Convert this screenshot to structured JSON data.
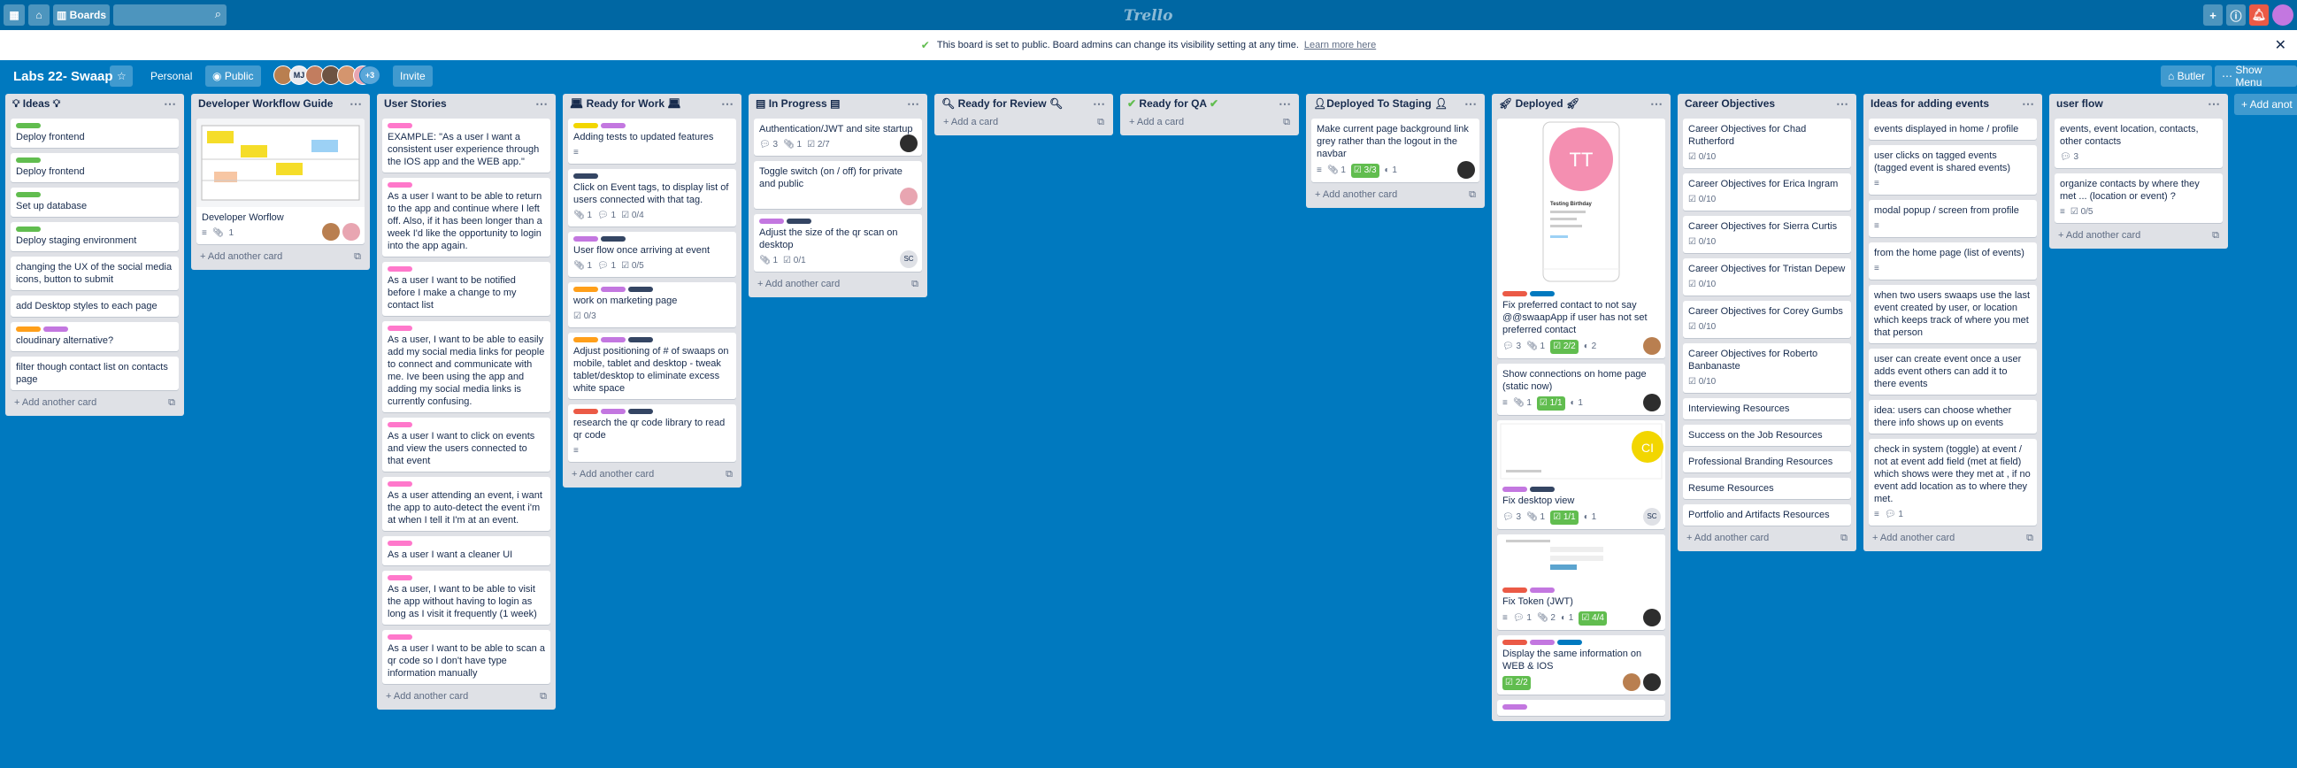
{
  "topbar": {
    "boards_label": "Boards",
    "logo": "Trello"
  },
  "banner": {
    "text": "This board is set to public. Board admins can change its visibility setting at any time.",
    "link": "Learn more here"
  },
  "board": {
    "title": "Labs 22- Swaap",
    "team": "Personal",
    "visibility": "Public",
    "member_more": "+3",
    "invite": "Invite",
    "butler": "Butler",
    "show_menu": "Show Menu",
    "member_initials": "MJ"
  },
  "add_card_label": "Add a card",
  "add_another_card_label": "Add another card",
  "add_list_label": "+ Add anot",
  "lists": {
    "ideas": {
      "title": "Ideas",
      "cards": [
        "Deploy frontend",
        "Deploy frontend",
        "Set up database",
        "Deploy staging environment",
        "changing the UX of the social media icons, button to submit",
        "add Desktop styles to each page",
        "cloudinary alternative?",
        "filter though contact list on contacts page"
      ]
    },
    "dev": {
      "title": "Developer Workflow Guide",
      "cards": [
        "Developer Worflow"
      ],
      "badge": "1"
    },
    "stories": {
      "title": "User Stories",
      "cards": [
        "EXAMPLE: \"As a user I want a consistent user experience through the IOS app and the WEB app.\"",
        "As a user I want to be able to return to the app and continue where I left off. Also, if it has been longer than a week I'd like the opportunity to login into the app again.",
        "As a user I want to be notified before I make a change to my contact list",
        "As a user, I want to be able to easily add my social media links for people to connect and communicate with me. Ive been using the app and adding my social media links is currently confusing.",
        "As a user I want to click on events and view the users connected to that event",
        "As a user attending an event, i want the app to auto-detect the event i'm at when I tell it I'm at an event.",
        "As a user I want a cleaner UI",
        "As a user, I want to be able to visit the app without having to login as long as I visit it frequently (1 week)",
        "As a user I want to be able to scan a qr code so I don't have type information manually"
      ]
    },
    "ready_work": {
      "title": "Ready for Work",
      "cards": [
        "Adding tests to updated features",
        "Click on Event tags, to display list of users connected with that tag.",
        "User flow once arriving at event",
        "work on marketing page",
        "Adjust positioning of # of swaaps on mobile, tablet and desktop - tweak tablet/desktop to eliminate excess white space",
        "research the qr code library to read qr code"
      ],
      "b1": "1",
      "b2": "1",
      "b3": "0/4",
      "b4": "1",
      "b5": "1",
      "b6": "0/5",
      "b7": "0/3"
    },
    "progress": {
      "title": "In Progress",
      "cards": [
        "Authentication/JWT and site startup",
        "Toggle switch (on / off) for private and public",
        "Adjust the size of the qr scan on desktop"
      ],
      "b1": "3",
      "b2": "1",
      "b3": "2/7",
      "b4": "1",
      "b5": "0/1",
      "sc": "SC"
    },
    "review": {
      "title": "Ready for Review"
    },
    "qa": {
      "title": "Ready for QA"
    },
    "staging": {
      "title": "Deployed To Staging",
      "cards": [
        "Make current page background link grey rather than the logout in the navbar"
      ],
      "b1": "1",
      "b2": "3/3",
      "b3": "1"
    },
    "deployed": {
      "title": "Deployed",
      "cards": [
        "Fix preferred contact to not say @@swaapApp if user has not set preferred contact",
        "Show connections on home page (static now)",
        "Fix desktop view",
        "Fix Token (JWT)",
        "Display the same information on WEB & IOS"
      ],
      "tt": "TT",
      "ci": "CI",
      "sc": "SC",
      "preview_name": "Testing Birthday",
      "c1b": [
        "3",
        "1",
        "2/2",
        "2"
      ],
      "c2b": [
        "1",
        "1/1",
        "1"
      ],
      "c3b": [
        "3",
        "1",
        "1/1",
        "1"
      ],
      "c4b": [
        "1",
        "2",
        "1",
        "4/4"
      ],
      "c5b": [
        "2/2"
      ]
    },
    "career": {
      "title": "Career Objectives",
      "cards": [
        "Career Objectives for Chad Rutherford",
        "Career Objectives for Erica Ingram",
        "Career Objectives for Sierra Curtis",
        "Career Objectives for Tristan Depew",
        "Career Objectives for Corey Gumbs",
        "Career Objectives for Roberto Banbanaste",
        "Interviewing Resources",
        "Success on the Job Resources",
        "Professional Branding Resources",
        "Resume Resources",
        "Portfolio and Artifacts Resources"
      ],
      "count": "0/10"
    },
    "events": {
      "title": "Ideas for adding events",
      "cards": [
        "events displayed in home / profile",
        "user clicks on tagged events (tagged event is shared events)",
        "modal popup / screen from profile",
        "from the home page (list of events)",
        "when two users swaaps use the last event created by user, or location which keeps track of where you met that person",
        "user can create event once a user adds event others can add it to there events",
        "idea: users can choose whether there info shows up on events",
        "check in system (toggle) at event / not at event add field (met at field) which shows were they met at , if no event add location as to where they met."
      ],
      "b1": "1"
    },
    "flow": {
      "title": "user flow",
      "cards": [
        "events, event location, contacts, other contacts",
        "organize contacts by where they met ... (location or event) ?"
      ],
      "b1": "3",
      "b2": "0/5"
    }
  }
}
